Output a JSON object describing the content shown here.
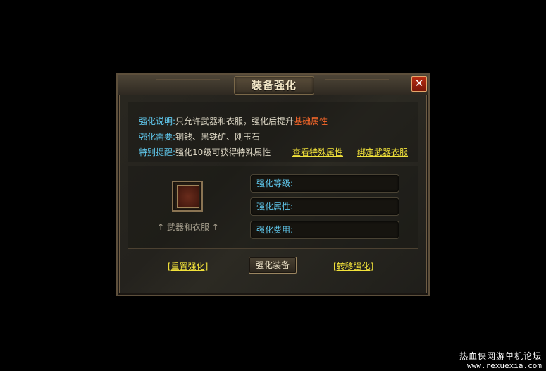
{
  "dialog": {
    "title": "装备强化",
    "close_label": "✕",
    "info": {
      "line1_label": "强化说明:",
      "line1_text": "只允许武器和衣服，强化后提升",
      "line1_highlight": "基础属性",
      "line2_label": "强化需要:",
      "line2_text": "铜钱、黑铁矿、刚玉石",
      "line3_label": "特别提醒:",
      "line3_text": "强化10级可获得特殊属性",
      "link_view_special": "查看特殊属性",
      "link_bind": "绑定武器衣服"
    },
    "slot_hint": "↑ 武器和衣服 ↑",
    "fields": {
      "level_label": "强化等级:",
      "attr_label": "强化属性:",
      "cost_label": "强化费用:"
    },
    "buttons": {
      "reset": "[重置强化]",
      "enhance": "强化装备",
      "transfer": "[转移强化]"
    },
    "colors": {
      "label": "#5fc6ea",
      "highlight": "#ff6a2a",
      "link": "#f2e23a",
      "close": "#b82d12"
    }
  },
  "footer": {
    "site_name": "热血侠网游单机论坛",
    "site_url": "www.rexuexia.com"
  }
}
